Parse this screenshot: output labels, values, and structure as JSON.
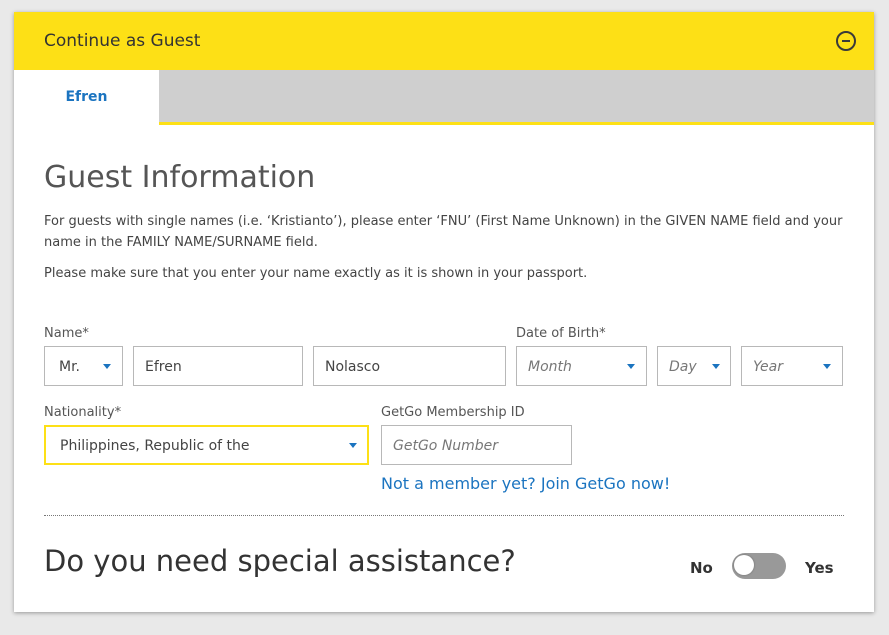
{
  "header": {
    "title": "Continue as Guest",
    "collapse_icon": "minus-circle-icon"
  },
  "tabs": [
    {
      "label": "Efren",
      "active": true
    }
  ],
  "guest_info": {
    "title": "Guest Information",
    "note1": "For guests with single names (i.e. ‘Kristianto’), please enter ‘FNU’ (First Name Unknown) in the GIVEN NAME field and your name in the FAMILY NAME/SURNAME field.",
    "note2": "Please make sure that you enter your name exactly as it is shown in your passport."
  },
  "form": {
    "name_label": "Name*",
    "title_value": "Mr.",
    "given_name": "Efren",
    "family_name": "Nolasco",
    "dob_label": "Date of Birth*",
    "month_placeholder": "Month",
    "day_placeholder": "Day",
    "year_placeholder": "Year",
    "nationality_label": "Nationality*",
    "nationality_value": "Philippines, Republic of the",
    "getgo_label": "GetGo Membership ID",
    "getgo_placeholder": "GetGo Number",
    "getgo_link": "Not a member yet? Join GetGo now!"
  },
  "assistance": {
    "title": "Do you need special assistance?",
    "no_label": "No",
    "yes_label": "Yes",
    "toggle_on": false
  },
  "colors": {
    "accent": "#fde016",
    "link": "#1b74c0",
    "toggle_off": "#999999"
  }
}
